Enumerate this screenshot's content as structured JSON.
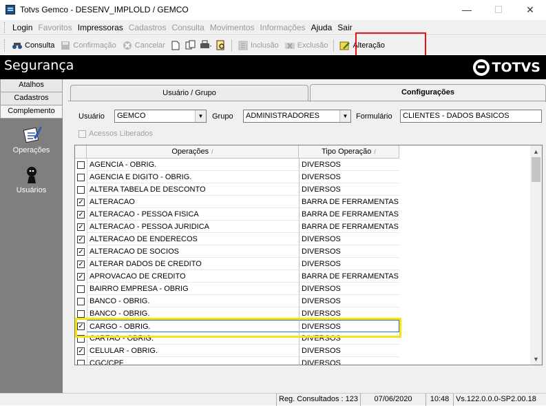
{
  "window": {
    "title": "Totvs Gemco - DESENV_IMPLOLD / GEMCO",
    "controls": [
      "—",
      "☐",
      "✕"
    ]
  },
  "menu": [
    {
      "label": "Login",
      "enabled": true
    },
    {
      "label": "Favoritos",
      "enabled": false
    },
    {
      "label": "Impressoras",
      "enabled": true
    },
    {
      "label": "Cadastros",
      "enabled": false
    },
    {
      "label": "Consulta",
      "enabled": false
    },
    {
      "label": "Movimentos",
      "enabled": false
    },
    {
      "label": "Informações",
      "enabled": false
    },
    {
      "label": "Ajuda",
      "enabled": true
    },
    {
      "label": "Sair",
      "enabled": true
    }
  ],
  "toolbar": {
    "consulta": "Consulta",
    "confirmacao": "Confirmação",
    "cancelar": "Cancelar",
    "inclusao": "Inclusão",
    "exclusao": "Exclusão",
    "alteracao": "Alteração"
  },
  "header": {
    "title": "Segurança",
    "logo_text": "TOTVS"
  },
  "sidebar": {
    "tabs": [
      "Atalhos",
      "Cadastros",
      "Complemento"
    ],
    "operacoes": "Operações",
    "usuarios": "Usuários"
  },
  "tabs": {
    "usuario_grupo": "Usuário  / Grupo",
    "configuracoes": "Configurações"
  },
  "form": {
    "usuario_label": "Usuário",
    "usuario_value": "GEMCO",
    "grupo_label": "Grupo",
    "grupo_value": "ADMINISTRADORES",
    "formulario_label": "Formulário",
    "formulario_value": "CLIENTES - DADOS BASICOS",
    "acessos_liberados": "Acessos Liberados"
  },
  "grid": {
    "col_operacoes": "Operações",
    "col_tipo": "Tipo Operação",
    "rows": [
      {
        "checked": false,
        "operacao": "AGENCIA - OBRIG.",
        "tipo": "DIVERSOS"
      },
      {
        "checked": false,
        "operacao": "AGENCIA E DIGITO - OBRIG.",
        "tipo": "DIVERSOS"
      },
      {
        "checked": false,
        "operacao": "ALTERA TABELA DE DESCONTO",
        "tipo": "DIVERSOS"
      },
      {
        "checked": true,
        "operacao": "ALTERACAO",
        "tipo": "BARRA DE FERRAMENTAS"
      },
      {
        "checked": true,
        "operacao": "ALTERACAO - PESSOA FISICA",
        "tipo": "BARRA DE FERRAMENTAS"
      },
      {
        "checked": true,
        "operacao": "ALTERACAO - PESSOA JURIDICA",
        "tipo": "BARRA DE FERRAMENTAS"
      },
      {
        "checked": true,
        "operacao": "ALTERACAO DE ENDERECOS",
        "tipo": "DIVERSOS"
      },
      {
        "checked": true,
        "operacao": "ALTERACAO DE SOCIOS",
        "tipo": "DIVERSOS"
      },
      {
        "checked": true,
        "operacao": "ALTERAR DADOS DE CREDITO",
        "tipo": "DIVERSOS"
      },
      {
        "checked": true,
        "operacao": "APROVACAO DE CREDITO",
        "tipo": "BARRA DE FERRAMENTAS"
      },
      {
        "checked": false,
        "operacao": "BAIRRO EMPRESA - OBRIG",
        "tipo": "DIVERSOS"
      },
      {
        "checked": false,
        "operacao": "BANCO - OBRIG.",
        "tipo": "DIVERSOS"
      },
      {
        "checked": false,
        "operacao": "BANCO - OBRIG.",
        "tipo": "DIVERSOS"
      },
      {
        "checked": true,
        "operacao": "CARGO - OBRIG.",
        "tipo": "DIVERSOS",
        "selected": true
      },
      {
        "checked": false,
        "operacao": "CARTAO - OBRIG.",
        "tipo": "DIVERSOS"
      },
      {
        "checked": true,
        "operacao": "CELULAR - OBRIG.",
        "tipo": "DIVERSOS"
      },
      {
        "checked": false,
        "operacao": "CGC/CPF",
        "tipo": "DIVERSOS"
      }
    ]
  },
  "status": {
    "reg_consultados": "Reg. Consultados : 123",
    "date": "07/06/2020",
    "time": "10:48",
    "version": "Vs.122.0.0.0-SP2.00.18"
  },
  "colors": {
    "highlight_red": "#e8101a",
    "highlight_yellow": "#f5e612",
    "header_bg": "#000000",
    "sidebar_bg": "#7f7f7f"
  }
}
